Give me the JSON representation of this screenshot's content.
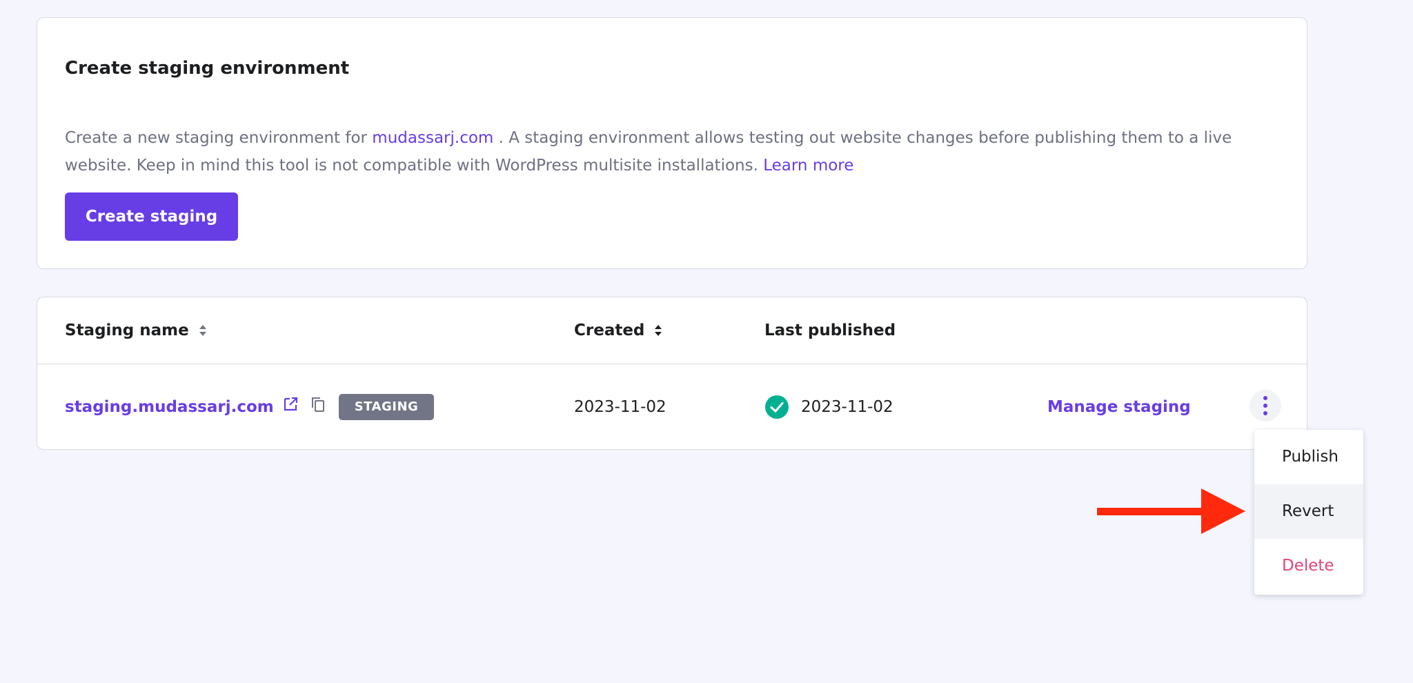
{
  "create_section": {
    "title": "Create staging environment",
    "desc_prefix": "Create a new staging environment for ",
    "domain_link": "mudassarj.com",
    "desc_middle": " . A staging environment allows testing out website changes before publishing them to a live website. Keep in mind this tool is not compatible with WordPress multisite installations. ",
    "learn_more": "Learn more",
    "create_button": "Create staging"
  },
  "table": {
    "columns": {
      "name": "Staging name",
      "created": "Created",
      "last_published": "Last published"
    },
    "rows": [
      {
        "name": "staging.mudassarj.com",
        "badge": "STAGING",
        "created": "2023-11-02",
        "last_published": "2023-11-02",
        "action": "Manage staging"
      }
    ]
  },
  "dropdown": {
    "items": [
      {
        "label": "Publish"
      },
      {
        "label": "Revert"
      },
      {
        "label": "Delete"
      }
    ]
  },
  "colors": {
    "accent": "#673de6",
    "badge": "#727586",
    "success": "#00b090",
    "danger": "#e0457b",
    "annotation_arrow": "#ff2a0e"
  },
  "icons": {
    "sort": "sort-icon",
    "external": "external-link-icon",
    "copy": "copy-icon",
    "check": "check-circle-icon",
    "more": "more-vertical-icon"
  }
}
